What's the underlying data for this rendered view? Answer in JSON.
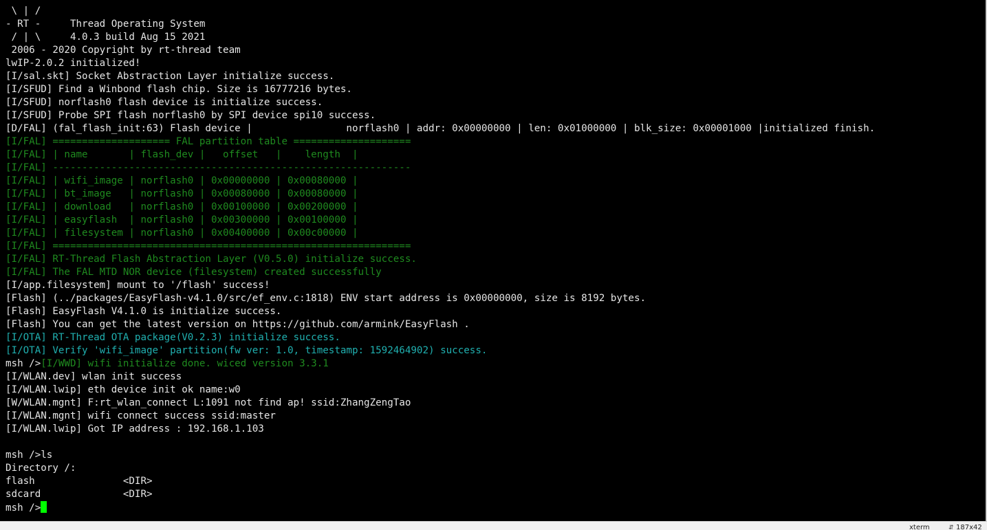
{
  "colors": {
    "background": "#000000",
    "default_text": "#e6e6e6",
    "green_log": "#1f8a1f",
    "cyan_log": "#20b0b0",
    "cursor": "#00ff00",
    "statusbar_bg": "#f0f0f0"
  },
  "terminal": {
    "prompt": "msh />",
    "lines": [
      {
        "segments": [
          {
            "text": " \\ | /",
            "color": "white"
          }
        ]
      },
      {
        "segments": [
          {
            "text": "- RT -     Thread Operating System",
            "color": "white"
          }
        ]
      },
      {
        "segments": [
          {
            "text": " / | \\     4.0.3 build Aug 15 2021",
            "color": "white"
          }
        ]
      },
      {
        "segments": [
          {
            "text": " 2006 - 2020 Copyright by rt-thread team",
            "color": "white"
          }
        ]
      },
      {
        "segments": [
          {
            "text": "lwIP-2.0.2 initialized!",
            "color": "white"
          }
        ]
      },
      {
        "segments": [
          {
            "text": "[I/sal.skt] Socket Abstraction Layer initialize success.",
            "color": "white"
          }
        ]
      },
      {
        "segments": [
          {
            "text": "[I/SFUD] Find a Winbond flash chip. Size is 16777216 bytes.",
            "color": "white"
          }
        ]
      },
      {
        "segments": [
          {
            "text": "[I/SFUD] norflash0 flash device is initialize success.",
            "color": "white"
          }
        ]
      },
      {
        "segments": [
          {
            "text": "[I/SFUD] Probe SPI flash norflash0 by SPI device spi10 success.",
            "color": "white"
          }
        ]
      },
      {
        "segments": [
          {
            "text": "[D/FAL] (fal_flash_init:63) Flash device |                norflash0 | addr: 0x00000000 | len: 0x01000000 | blk_size: 0x00001000 |initialized finish.",
            "color": "white"
          }
        ]
      },
      {
        "segments": [
          {
            "text": "[I/FAL] ==================== FAL partition table ====================",
            "color": "green"
          }
        ]
      },
      {
        "segments": [
          {
            "text": "[I/FAL] | name       | flash_dev |   offset   |    length  |",
            "color": "green"
          }
        ]
      },
      {
        "segments": [
          {
            "text": "[I/FAL] -------------------------------------------------------------",
            "color": "green"
          }
        ]
      },
      {
        "segments": [
          {
            "text": "[I/FAL] | wifi_image | norflash0 | 0x00000000 | 0x00080000 |",
            "color": "green"
          }
        ]
      },
      {
        "segments": [
          {
            "text": "[I/FAL] | bt_image   | norflash0 | 0x00080000 | 0x00080000 |",
            "color": "green"
          }
        ]
      },
      {
        "segments": [
          {
            "text": "[I/FAL] | download   | norflash0 | 0x00100000 | 0x00200000 |",
            "color": "green"
          }
        ]
      },
      {
        "segments": [
          {
            "text": "[I/FAL] | easyflash  | norflash0 | 0x00300000 | 0x00100000 |",
            "color": "green"
          }
        ]
      },
      {
        "segments": [
          {
            "text": "[I/FAL] | filesystem | norflash0 | 0x00400000 | 0x00c00000 |",
            "color": "green"
          }
        ]
      },
      {
        "segments": [
          {
            "text": "[I/FAL] =============================================================",
            "color": "green"
          }
        ]
      },
      {
        "segments": [
          {
            "text": "[I/FAL] RT-Thread Flash Abstraction Layer (V0.5.0) initialize success.",
            "color": "green"
          }
        ]
      },
      {
        "segments": [
          {
            "text": "[I/FAL] The FAL MTD NOR device (filesystem) created successfully",
            "color": "green"
          }
        ]
      },
      {
        "segments": [
          {
            "text": "[I/app.filesystem] mount to '/flash' success!",
            "color": "white"
          }
        ]
      },
      {
        "segments": [
          {
            "text": "[Flash] (../packages/EasyFlash-v4.1.0/src/ef_env.c:1818) ENV start address is 0x00000000, size is 8192 bytes.",
            "color": "white"
          }
        ]
      },
      {
        "segments": [
          {
            "text": "[Flash] EasyFlash V4.1.0 is initialize success.",
            "color": "white"
          }
        ]
      },
      {
        "segments": [
          {
            "text": "[Flash] You can get the latest version on https://github.com/armink/EasyFlash .",
            "color": "white"
          }
        ]
      },
      {
        "segments": [
          {
            "text": "[I/OTA] RT-Thread OTA package(V0.2.3) initialize success.",
            "color": "cyan"
          }
        ]
      },
      {
        "segments": [
          {
            "text": "[I/OTA] Verify 'wifi_image' partition(fw ver: 1.0, timestamp: 1592464902) success.",
            "color": "cyan"
          }
        ]
      },
      {
        "segments": [
          {
            "text": "msh />",
            "color": "white"
          },
          {
            "text": "[I/WWD] wifi initialize done. wiced version 3.3.1",
            "color": "green"
          }
        ]
      },
      {
        "segments": [
          {
            "text": "[I/WLAN.dev] wlan init success",
            "color": "white"
          }
        ]
      },
      {
        "segments": [
          {
            "text": "[I/WLAN.lwip] eth device init ok name:w0",
            "color": "white"
          }
        ]
      },
      {
        "segments": [
          {
            "text": "[W/WLAN.mgnt] F:rt_wlan_connect L:1091 not find ap! ssid:ZhangZengTao",
            "color": "white"
          }
        ]
      },
      {
        "segments": [
          {
            "text": "[I/WLAN.mgnt] wifi connect success ssid:master",
            "color": "white"
          }
        ]
      },
      {
        "segments": [
          {
            "text": "[I/WLAN.lwip] Got IP address : 192.168.1.103",
            "color": "white"
          }
        ]
      },
      {
        "segments": [
          {
            "text": "",
            "color": "white"
          }
        ]
      },
      {
        "segments": [
          {
            "text": "msh />ls",
            "color": "white"
          }
        ]
      },
      {
        "segments": [
          {
            "text": "Directory /:",
            "color": "white"
          }
        ]
      },
      {
        "segments": [
          {
            "text": "flash               <DIR>",
            "color": "white"
          }
        ]
      },
      {
        "segments": [
          {
            "text": "sdcard              <DIR>",
            "color": "white"
          }
        ]
      }
    ]
  },
  "statusbar": {
    "app_label": "xterm",
    "size_icon": "resize-icon",
    "size_label": "187x42"
  }
}
